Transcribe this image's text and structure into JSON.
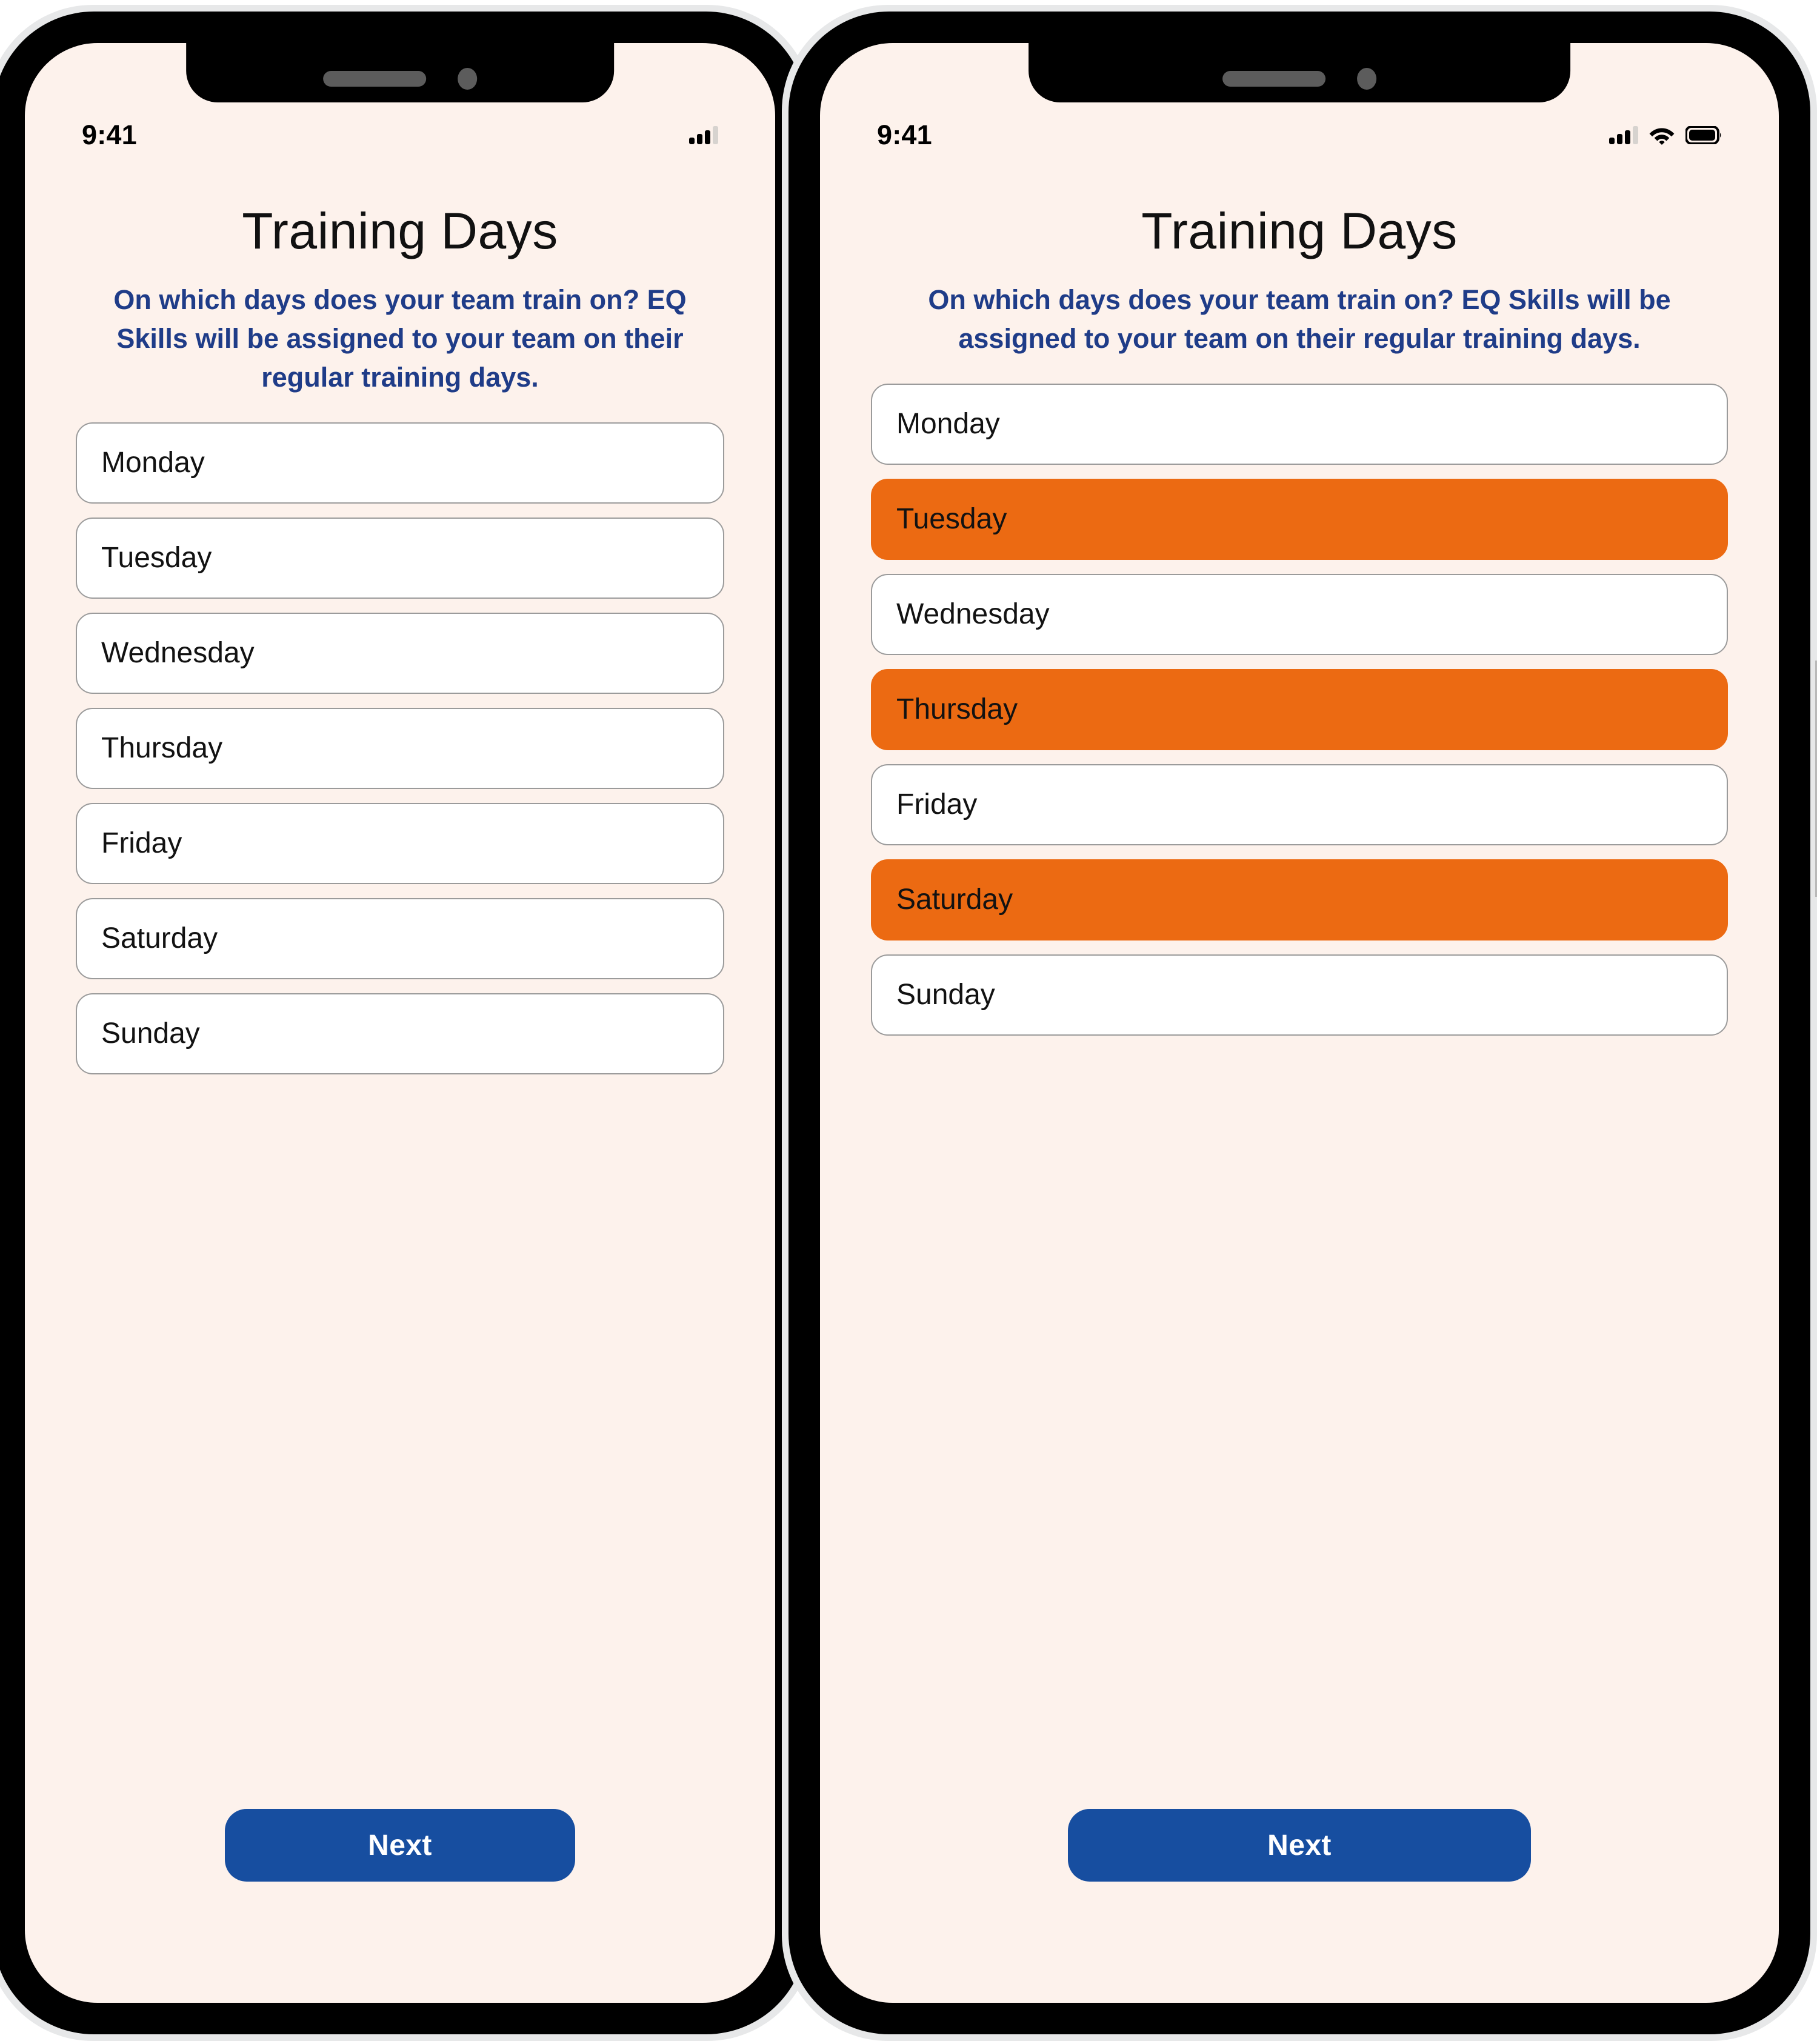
{
  "theme": {
    "background": "#fdf2ec",
    "accent_orange": "#ec6a12",
    "accent_blue": "#174ea0",
    "subtitle_blue": "#1f3c88",
    "bezel": "#000000",
    "rim": "#e7e8e9"
  },
  "screens": [
    {
      "id": "left",
      "status_bar": {
        "time": "9:41",
        "icons": [
          "cellular-bars-icon"
        ]
      },
      "title": "Training Days",
      "subtitle": "On which days does your team train on? EQ Skills will be assigned to your team on their regular training days.",
      "days": [
        {
          "label": "Monday",
          "selected": false
        },
        {
          "label": "Tuesday",
          "selected": false
        },
        {
          "label": "Wednesday",
          "selected": false
        },
        {
          "label": "Thursday",
          "selected": false
        },
        {
          "label": "Friday",
          "selected": false
        },
        {
          "label": "Saturday",
          "selected": false
        },
        {
          "label": "Sunday",
          "selected": false
        }
      ],
      "next_label": "Next"
    },
    {
      "id": "right",
      "status_bar": {
        "time": "9:41",
        "icons": [
          "cellular-bars-icon",
          "wifi-icon",
          "battery-icon"
        ]
      },
      "title": "Training Days",
      "subtitle": "On which days does your team train on? EQ Skills will be assigned to your team on their regular training days.",
      "days": [
        {
          "label": "Monday",
          "selected": false
        },
        {
          "label": "Tuesday",
          "selected": true
        },
        {
          "label": "Wednesday",
          "selected": false
        },
        {
          "label": "Thursday",
          "selected": true
        },
        {
          "label": "Friday",
          "selected": false
        },
        {
          "label": "Saturday",
          "selected": true
        },
        {
          "label": "Sunday",
          "selected": false
        }
      ],
      "next_label": "Next"
    }
  ]
}
